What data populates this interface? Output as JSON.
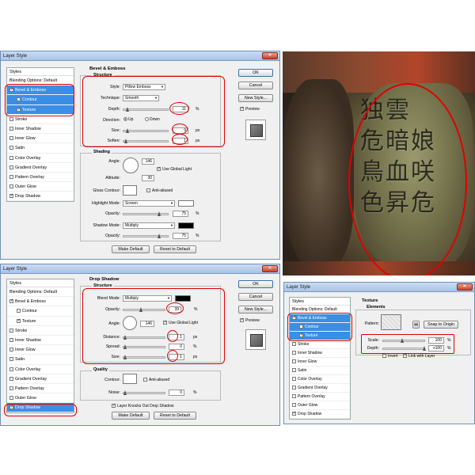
{
  "dialog1": {
    "title": "Layer Style",
    "styles_header": "Styles",
    "style_items": [
      {
        "label": "Blending Options: Default",
        "checkbox": false,
        "checked": false,
        "selected": false,
        "indent": false
      },
      {
        "label": "Bevel & Emboss",
        "checkbox": true,
        "checked": true,
        "selected": true,
        "indent": false
      },
      {
        "label": "Contour",
        "checkbox": true,
        "checked": false,
        "selected": true,
        "indent": true
      },
      {
        "label": "Texture",
        "checkbox": true,
        "checked": true,
        "selected": true,
        "indent": true
      },
      {
        "label": "Stroke",
        "checkbox": true,
        "checked": false,
        "selected": false,
        "indent": false
      },
      {
        "label": "Inner Shadow",
        "checkbox": true,
        "checked": false,
        "selected": false,
        "indent": false
      },
      {
        "label": "Inner Glow",
        "checkbox": true,
        "checked": false,
        "selected": false,
        "indent": false
      },
      {
        "label": "Satin",
        "checkbox": true,
        "checked": false,
        "selected": false,
        "indent": false
      },
      {
        "label": "Color Overlay",
        "checkbox": true,
        "checked": false,
        "selected": false,
        "indent": false
      },
      {
        "label": "Gradient Overlay",
        "checkbox": true,
        "checked": false,
        "selected": false,
        "indent": false
      },
      {
        "label": "Pattern Overlay",
        "checkbox": true,
        "checked": false,
        "selected": false,
        "indent": false
      },
      {
        "label": "Outer Glow",
        "checkbox": true,
        "checked": false,
        "selected": false,
        "indent": false
      },
      {
        "label": "Drop Shadow",
        "checkbox": true,
        "checked": true,
        "selected": false,
        "indent": false
      }
    ],
    "section_title": "Bevel & Emboss",
    "structure_title": "Structure",
    "style_label": "Style:",
    "style_value": "Pillow Emboss",
    "technique_label": "Technique:",
    "technique_value": "Smooth",
    "depth_label": "Depth:",
    "depth_value": "11",
    "depth_unit": "%",
    "direction_label": "Direction:",
    "direction_up": "Up",
    "direction_down": "Down",
    "size_label": "Size:",
    "size_value": "9",
    "size_unit": "px",
    "soften_label": "Soften:",
    "soften_value": "1",
    "soften_unit": "px",
    "shading_title": "Shading",
    "angle_label": "Angle:",
    "angle_value": "146",
    "global_light_label": "Use Global Light",
    "altitude_label": "Altitude:",
    "altitude_value": "30",
    "gloss_label": "Gloss Contour:",
    "anti_aliased_label": "Anti-aliased",
    "highlight_label": "Highlight Mode:",
    "highlight_value": "Screen",
    "opacity_label": "Opacity:",
    "highlight_opacity": "75",
    "pct": "%",
    "shadow_label": "Shadow Mode:",
    "shadow_value": "Multiply",
    "shadow_opacity": "75",
    "make_default": "Make Default",
    "reset_default": "Reset to Default",
    "ok": "OK",
    "cancel": "Cancel",
    "new_style": "New Style...",
    "preview": "Preview"
  },
  "dialog2": {
    "title": "Layer Style",
    "styles_header": "Styles",
    "style_items": [
      {
        "label": "Blending Options: Default",
        "checkbox": false,
        "checked": false,
        "selected": false,
        "indent": false
      },
      {
        "label": "Bevel & Emboss",
        "checkbox": true,
        "checked": true,
        "selected": false,
        "indent": false
      },
      {
        "label": "Contour",
        "checkbox": true,
        "checked": false,
        "selected": false,
        "indent": true
      },
      {
        "label": "Texture",
        "checkbox": true,
        "checked": true,
        "selected": false,
        "indent": true
      },
      {
        "label": "Stroke",
        "checkbox": true,
        "checked": false,
        "selected": false,
        "indent": false
      },
      {
        "label": "Inner Shadow",
        "checkbox": true,
        "checked": false,
        "selected": false,
        "indent": false
      },
      {
        "label": "Inner Glow",
        "checkbox": true,
        "checked": false,
        "selected": false,
        "indent": false
      },
      {
        "label": "Satin",
        "checkbox": true,
        "checked": false,
        "selected": false,
        "indent": false
      },
      {
        "label": "Color Overlay",
        "checkbox": true,
        "checked": false,
        "selected": false,
        "indent": false
      },
      {
        "label": "Gradient Overlay",
        "checkbox": true,
        "checked": false,
        "selected": false,
        "indent": false
      },
      {
        "label": "Pattern Overlay",
        "checkbox": true,
        "checked": false,
        "selected": false,
        "indent": false
      },
      {
        "label": "Outer Glow",
        "checkbox": true,
        "checked": false,
        "selected": false,
        "indent": false
      },
      {
        "label": "Drop Shadow",
        "checkbox": true,
        "checked": true,
        "selected": true,
        "indent": false
      }
    ],
    "section_title": "Drop Shadow",
    "structure_title": "Structure",
    "blend_label": "Blend Mode:",
    "blend_value": "Multiply",
    "opacity_label": "Opacity:",
    "opacity_value": "39",
    "pct": "%",
    "angle_label": "Angle:",
    "angle_value": "146",
    "global_light_label": "Use Global Light",
    "distance_label": "Distance:",
    "distance_value": "1",
    "px": "px",
    "spread_label": "Spread:",
    "spread_value": "0",
    "size_label": "Size:",
    "size_value": "1",
    "quality_title": "Quality",
    "contour_label": "Contour:",
    "anti_aliased_label": "Anti-aliased",
    "noise_label": "Noise:",
    "noise_value": "0",
    "knockout_label": "Layer Knocks Out Drop Shadow",
    "make_default": "Make Default",
    "reset_default": "Reset to Default",
    "ok": "OK",
    "cancel": "Cancel",
    "new_style": "New Style...",
    "preview": "Preview"
  },
  "dialog3": {
    "title": "Layer Style",
    "styles_header": "Styles",
    "style_items": [
      {
        "label": "Blending Options: Default",
        "checkbox": false,
        "checked": false,
        "selected": false,
        "indent": false
      },
      {
        "label": "Bevel & Emboss",
        "checkbox": true,
        "checked": true,
        "selected": true,
        "indent": false
      },
      {
        "label": "Contour",
        "checkbox": true,
        "checked": false,
        "selected": true,
        "indent": true
      },
      {
        "label": "Texture",
        "checkbox": true,
        "checked": true,
        "selected": true,
        "indent": true
      },
      {
        "label": "Stroke",
        "checkbox": true,
        "checked": false,
        "selected": false,
        "indent": false
      },
      {
        "label": "Inner Shadow",
        "checkbox": true,
        "checked": false,
        "selected": false,
        "indent": false
      },
      {
        "label": "Inner Glow",
        "checkbox": true,
        "checked": false,
        "selected": false,
        "indent": false
      },
      {
        "label": "Satin",
        "checkbox": true,
        "checked": false,
        "selected": false,
        "indent": false
      },
      {
        "label": "Color Overlay",
        "checkbox": true,
        "checked": false,
        "selected": false,
        "indent": false
      },
      {
        "label": "Gradient Overlay",
        "checkbox": true,
        "checked": false,
        "selected": false,
        "indent": false
      },
      {
        "label": "Pattern Overlay",
        "checkbox": true,
        "checked": false,
        "selected": false,
        "indent": false
      },
      {
        "label": "Outer Glow",
        "checkbox": true,
        "checked": false,
        "selected": false,
        "indent": false
      },
      {
        "label": "Drop Shadow",
        "checkbox": true,
        "checked": true,
        "selected": false,
        "indent": false
      }
    ],
    "section_title": "Texture",
    "elements_title": "Elements",
    "pattern_label": "Pattern:",
    "snap_label": "Snap to Origin",
    "scale_label": "Scale:",
    "scale_value": "100",
    "pct": "%",
    "depth_label": "Depth:",
    "depth_value": "+100",
    "invert_label": "Invert",
    "link_label": "Link with Layer"
  },
  "photo": {
    "characters": [
      "独",
      "雲",
      "危",
      "暗",
      "娘",
      "鳥",
      "血",
      "咲",
      "色",
      "昇",
      "危"
    ]
  },
  "colors": {
    "highlight_red": "#e00000",
    "selection_blue": "#3a8ee6"
  }
}
